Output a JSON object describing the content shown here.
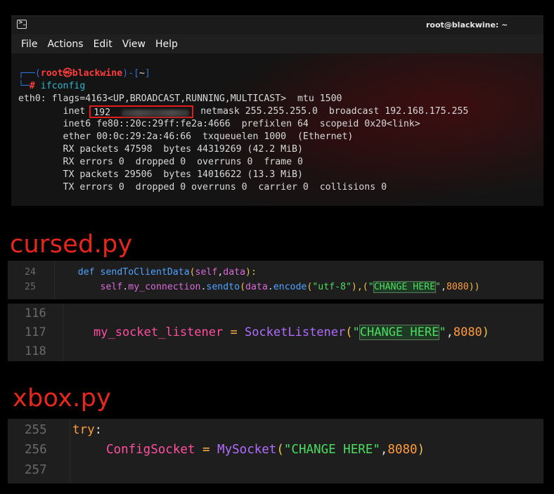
{
  "terminal": {
    "title": "root@blackwine: ~",
    "menu": [
      "File",
      "Actions",
      "Edit",
      "View",
      "Help"
    ],
    "prompt": {
      "frame_start": "┌──(",
      "user": "root",
      "at_symbol": "㉿",
      "host": "blackwine",
      "frame_mid": ")-[",
      "path": "~",
      "frame_end": "]",
      "line2_frame": "└─",
      "hash": "#",
      "command": "ifconfig"
    },
    "output": {
      "line1": "eth0: flags=4163<UP,BROADCAST,RUNNING,MULTICAST>  mtu 1500",
      "inet_label": "        inet ",
      "inet_visible": "192",
      "inet_rest": "netmask 255.255.255.0  broadcast 192.168.175.255",
      "line3": "        inet6 fe80::20c:29ff:fe2a:4666  prefixlen 64  scopeid 0x20<link>",
      "line4": "        ether 00:0c:29:2a:46:66  txqueuelen 1000  (Ethernet)",
      "line5": "        RX packets 47598  bytes 44319269 (42.2 MiB)",
      "line6": "        RX errors 0  dropped 0  overruns 0  frame 0",
      "line7": "        TX packets 29506  bytes 14016622 (13.3 MiB)",
      "line8": "        TX errors 0  dropped 0 overruns 0  carrier 0  collisions 0"
    }
  },
  "cursed": {
    "heading": "cursed.py",
    "block1": {
      "lines": [
        {
          "n": "24",
          "indent": "    ",
          "def": "def",
          "fn": "sendToClientData",
          "p1": "(",
          "self": "self",
          "c1": ",",
          "arg": "data",
          "p2": "):"
        },
        {
          "n": "25",
          "indent": "        ",
          "self": "self",
          "dot1": ".",
          "attr": "my_connection",
          "dot2": ".",
          "method": "sendto",
          "p1": "(",
          "data": "data",
          "dot3": ".",
          "encode": "encode",
          "p2": "(",
          "s1": "\"utf-8\"",
          "p3": "),(",
          "q1": "\"",
          "change": "CHANGE HERE",
          "q2": "\"",
          "c": ",",
          "port": "8080",
          "p4": "))"
        }
      ]
    },
    "block2": {
      "lines": [
        {
          "n": "116",
          "text": ""
        },
        {
          "n": "117",
          "var": "my_socket_listener",
          "eq": " = ",
          "cls": "SocketListener",
          "p1": "(",
          "q1": "\"",
          "change": "CHANGE HERE",
          "q2": "\"",
          "c": ",",
          "port": "8080",
          "p2": ")"
        },
        {
          "n": "118",
          "text": ""
        }
      ]
    }
  },
  "xbox": {
    "heading": "xbox.py",
    "lines": [
      {
        "n": "255",
        "kw": "try",
        "colon": ":"
      },
      {
        "n": "256",
        "var": "ConfigSocket",
        "eq": " = ",
        "cls": "MySocket",
        "p1": "(",
        "str": "\"CHANGE HERE\"",
        "c": ",",
        "port": "8080",
        "p2": ")"
      },
      {
        "n": "257",
        "text": ""
      }
    ]
  }
}
